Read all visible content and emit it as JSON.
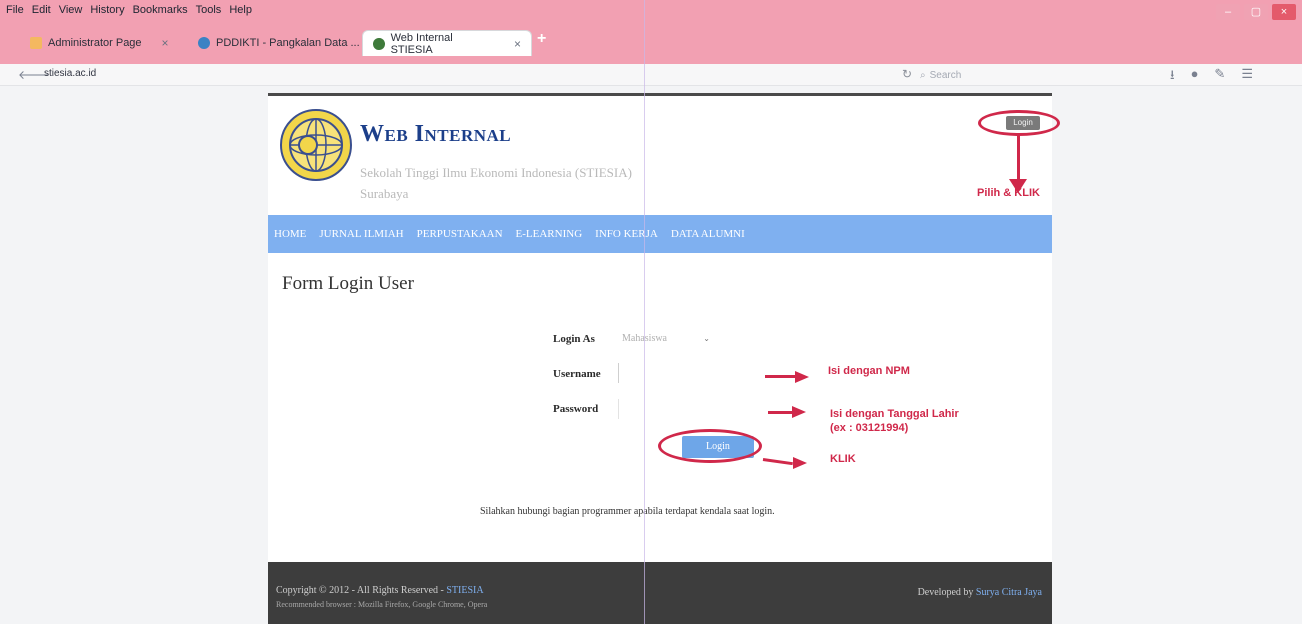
{
  "browser": {
    "menu": [
      "File",
      "Edit",
      "View",
      "History",
      "Bookmarks",
      "Tools",
      "Help"
    ],
    "tabs": [
      {
        "label": "Administrator Page",
        "active": false
      },
      {
        "label": "PDDIKTI - Pangkalan Data ...",
        "active": false
      },
      {
        "label": "Web Internal STIESIA",
        "active": true
      }
    ],
    "url_host": "stiesia.ac.id",
    "search_placeholder": "Search",
    "colors": {
      "chrome": "#f2a0b2",
      "annotation": "#d0284a"
    }
  },
  "header": {
    "title": "Web Internal",
    "subtitle_line1": "Sekolah Tinggi Ilmu Ekonomi Indonesia (STIESIA)",
    "subtitle_line2": "Surabaya",
    "top_login_label": "Login",
    "logo_icon": "stiesia-globe-logo"
  },
  "nav": {
    "items": [
      "HOME",
      "JURNAL ILMIAH",
      "PERPUSTAKAAN",
      "E-LEARNING",
      "INFO KERJA",
      "DATA ALUMNI"
    ],
    "color": "#7fb0f0"
  },
  "form": {
    "title": "Form Login User",
    "login_as_label": "Login As",
    "login_as_value": "Mahasiswa",
    "username_label": "Username",
    "password_label": "Password",
    "submit_label": "Login",
    "help_text": "Silahkan hubungi bagian programmer apabila terdapat kendala saat login."
  },
  "annotations": {
    "top": "Pilih & KLIK",
    "npm": "Isi dengan NPM",
    "password_line1": "Isi dengan Tanggal Lahir",
    "password_line2": "(ex : 03121994)",
    "klik": "KLIK"
  },
  "footer": {
    "copyright_prefix": "Copyright © 2012 - All Rights Reserved -",
    "copyright_link": "STIESIA",
    "browsers": "Recommended browser : Mozilla Firefox, Google Chrome, Opera",
    "developed_prefix": "Developed by",
    "developer": "Surya Citra Jaya"
  }
}
